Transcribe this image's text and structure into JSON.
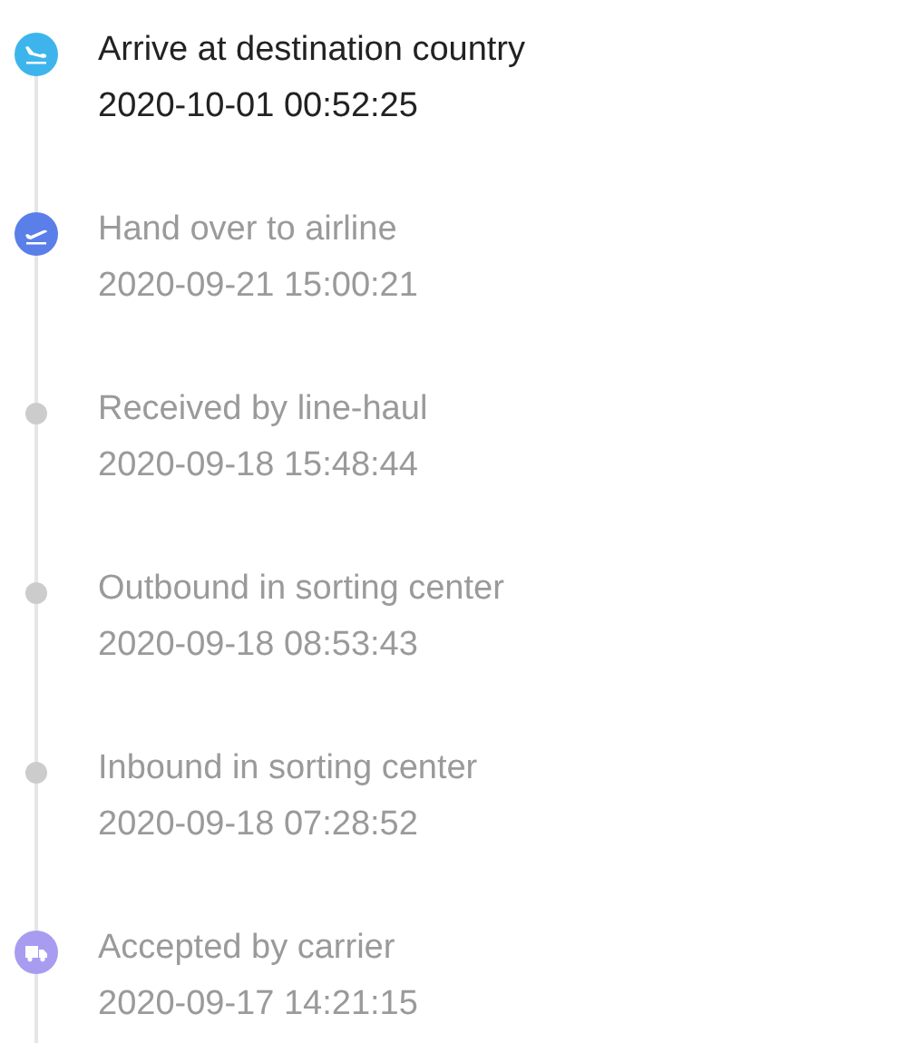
{
  "events": [
    {
      "kind": "arrival",
      "title": "Arrive at destination country",
      "time": "2020-10-01 00:52:25",
      "current": true,
      "color": "#3db5ec"
    },
    {
      "kind": "departure",
      "title": "Hand over to airline",
      "time": "2020-09-21 15:00:21",
      "current": false,
      "color": "#5b7fe8"
    },
    {
      "kind": "dot",
      "title": "Received by line-haul",
      "time": "2020-09-18 15:48:44",
      "current": false,
      "color": "#cccccc"
    },
    {
      "kind": "dot",
      "title": "Outbound in sorting center",
      "time": "2020-09-18 08:53:43",
      "current": false,
      "color": "#cccccc"
    },
    {
      "kind": "dot",
      "title": "Inbound in sorting center",
      "time": "2020-09-18 07:28:52",
      "current": false,
      "color": "#cccccc"
    },
    {
      "kind": "truck",
      "title": "Accepted by carrier",
      "time": "2020-09-17 14:21:15",
      "current": false,
      "color": "#a89cf0"
    }
  ]
}
